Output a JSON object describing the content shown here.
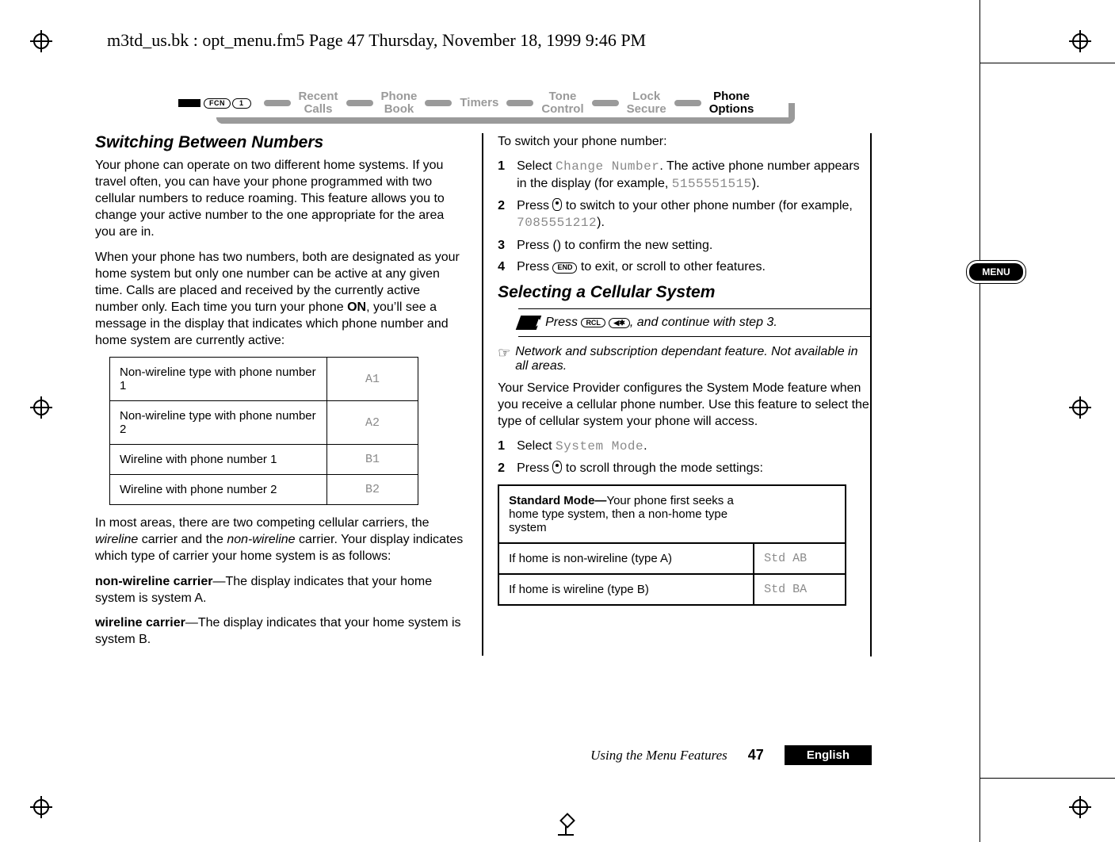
{
  "running_header": "m3td_us.bk : opt_menu.fm5  Page 47  Thursday, November 18, 1999  9:46 PM",
  "breadcrumb": {
    "fcn_label": "FCN",
    "one_label": "1",
    "items": [
      {
        "label": "Recent\nCalls",
        "active": false
      },
      {
        "label": "Phone\nBook",
        "active": false
      },
      {
        "label": "Timers",
        "active": false
      },
      {
        "label": "Tone\nControl",
        "active": false
      },
      {
        "label": "Lock\nSecure",
        "active": false
      },
      {
        "label": "Phone\nOptions",
        "active": true
      }
    ]
  },
  "left_col": {
    "heading": "Switching Between Numbers",
    "para1": "Your phone can operate on two different home systems. If you travel often, you can have your phone programmed with two cellular numbers to reduce roaming. This feature allows you to change your active number to the one appropriate for the area you are in.",
    "para2_a": "When your phone has two numbers, both are designated as your home system but only one number can be active at any given time. Calls are placed and received by the currently active number only. Each time you turn your phone ",
    "para2_on": "ON",
    "para2_b": ", you’ll see a message in the display that indicates which phone number and home system are currently active:",
    "table_rows": [
      {
        "label": "Non-wireline type with phone number 1",
        "code": "A1"
      },
      {
        "label": "Non-wireline type with phone number 2",
        "code": "A2"
      },
      {
        "label": "Wireline with phone number 1",
        "code": "B1"
      },
      {
        "label": "Wireline with phone number 2",
        "code": "B2"
      }
    ],
    "para3_a": "In most areas, there are two competing cellular carriers, the ",
    "para3_w": "wireline",
    "para3_b": " carrier and the ",
    "para3_nw": "non-wireline",
    "para3_c": " carrier. Your display indicates which type of carrier your home system is as follows:",
    "nw_label": "non-wireline carrier",
    "nw_text": "—The display indicates that your home system is system A.",
    "w_label": "wireline carrier",
    "w_text": "—The display indicates that your home system is system B."
  },
  "right_col": {
    "intro": "To switch your phone number:",
    "steps_a": [
      {
        "num": "1",
        "pre": "Select ",
        "code": "Change Number",
        "post": ". The active phone number appears in the display (for example, ",
        "code2": "5155551515",
        "post2": ")."
      },
      {
        "num": "2",
        "pre": "Press ",
        "icon": true,
        "post": " to switch to your other phone number (for example, ",
        "code": "7085551212",
        "post2": ")."
      },
      {
        "num": "3",
        "pre": "Press ",
        "glyph": "()",
        "post": " to confirm the new setting."
      },
      {
        "num": "4",
        "pre": "Press ",
        "key": "END",
        "post": " to exit, or scroll to other features."
      }
    ],
    "heading2": "Selecting a Cellular System",
    "shortcut": {
      "pre": "Press ",
      "key1": "RCL",
      "key2": "◀✱",
      "post": ", and continue with step 3."
    },
    "note_icon": "☞",
    "note_text": "Network and subscription dependant feature. Not available in all areas.",
    "para_sp": "Your Service Provider configures the System Mode feature when you receive a cellular phone number. Use this feature to select the type of cellular system your phone will access.",
    "steps_b": [
      {
        "num": "1",
        "pre": "Select ",
        "code": "System Mode",
        "post": "."
      },
      {
        "num": "2",
        "pre": "Press ",
        "icon": true,
        "post": " to scroll through the mode settings:"
      }
    ],
    "mode_table": {
      "head_bold": "Standard Mode—",
      "head_rest": "Your phone first seeks a home type system, then a non-home type system",
      "rows": [
        {
          "label": "If home is non-wireline (type A)",
          "code": "Std AB"
        },
        {
          "label": "If home is wireline (type B)",
          "code": "Std BA"
        }
      ]
    }
  },
  "menu_tab": "MENU",
  "footer": {
    "title": "Using the Menu Features",
    "page": "47",
    "lang": "English"
  }
}
